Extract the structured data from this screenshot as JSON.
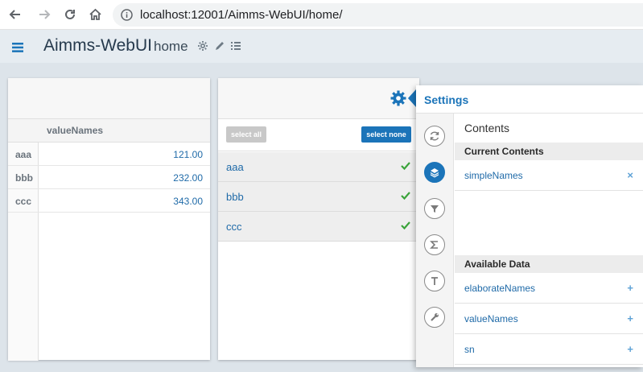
{
  "browser": {
    "url": "localhost:12001/Aimms-WebUI/home/",
    "back_icon": "arrow-left-icon",
    "forward_icon": "arrow-right-icon",
    "reload_icon": "reload-icon",
    "home_icon": "home-icon",
    "info_icon": "info-icon"
  },
  "header": {
    "app_title": "Aimms-WebUI",
    "page_name": "home",
    "menu_icon": "hamburger-icon",
    "icons": [
      "gear-icon",
      "pencil-icon",
      "list-icon"
    ]
  },
  "table_widget": {
    "column_header": "valueNames",
    "rows": [
      {
        "label": "aaa",
        "value": "121.00"
      },
      {
        "label": "bbb",
        "value": "232.00"
      },
      {
        "label": "ccc",
        "value": "343.00"
      }
    ]
  },
  "selection_widget": {
    "select_all_label": "select all",
    "select_none_label": "select none",
    "items": [
      {
        "label": "aaa",
        "checked": true
      },
      {
        "label": "bbb",
        "checked": true
      },
      {
        "label": "ccc",
        "checked": true
      }
    ]
  },
  "settings": {
    "title": "Settings",
    "tabs": [
      {
        "icon": "refresh-icon",
        "active": false
      },
      {
        "icon": "layers-icon",
        "active": true
      },
      {
        "icon": "filter-icon",
        "active": false
      },
      {
        "icon": "sigma-icon",
        "active": false
      },
      {
        "icon": "text-icon",
        "active": false
      },
      {
        "icon": "wrench-icon",
        "active": false
      }
    ],
    "contents_title": "Contents",
    "current_contents_heading": "Current Contents",
    "current_contents": [
      {
        "label": "simpleNames",
        "action": "×"
      }
    ],
    "available_data_heading": "Available Data",
    "available_data": [
      {
        "label": "elaborateNames",
        "action": "+"
      },
      {
        "label": "valueNames",
        "action": "+"
      },
      {
        "label": "sn",
        "action": "+"
      }
    ]
  },
  "colors": {
    "accent": "#1b74b9",
    "value_text": "#1f6aa8",
    "check": "#3aa33a"
  }
}
